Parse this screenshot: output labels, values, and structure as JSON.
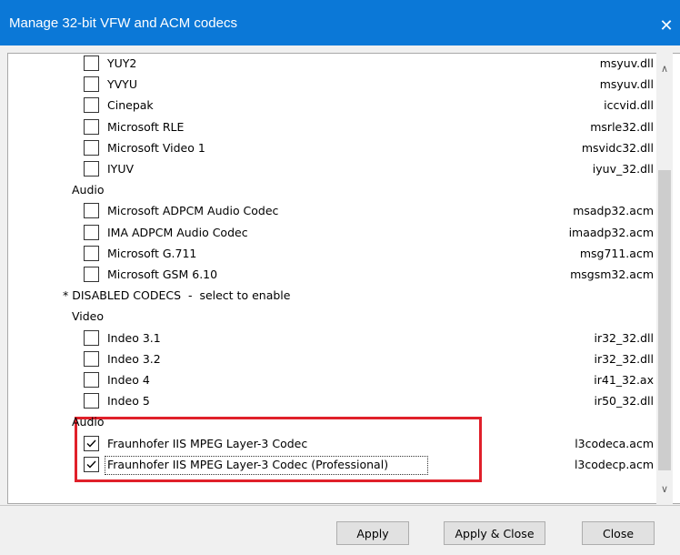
{
  "window": {
    "title": "Manage 32-bit VFW and ACM codecs",
    "close_glyph": "✕"
  },
  "list": {
    "rows": [
      {
        "type": "codec",
        "label": "YUY2",
        "file": "msyuv.dll",
        "checked": false
      },
      {
        "type": "codec",
        "label": "YVYU",
        "file": "msyuv.dll",
        "checked": false
      },
      {
        "type": "codec",
        "label": "Cinepak",
        "file": "iccvid.dll",
        "checked": false
      },
      {
        "type": "codec",
        "label": "Microsoft RLE",
        "file": "msrle32.dll",
        "checked": false
      },
      {
        "type": "codec",
        "label": "Microsoft Video 1",
        "file": "msvidc32.dll",
        "checked": false
      },
      {
        "type": "codec",
        "label": "IYUV",
        "file": "iyuv_32.dll",
        "checked": false
      },
      {
        "type": "group",
        "label": "Audio"
      },
      {
        "type": "codec",
        "label": "Microsoft ADPCM Audio Codec",
        "file": "msadp32.acm",
        "checked": false
      },
      {
        "type": "codec",
        "label": "IMA ADPCM Audio Codec",
        "file": "imaadp32.acm",
        "checked": false
      },
      {
        "type": "codec",
        "label": "Microsoft G.711",
        "file": "msg711.acm",
        "checked": false
      },
      {
        "type": "codec",
        "label": "Microsoft GSM 6.10",
        "file": "msgsm32.acm",
        "checked": false
      },
      {
        "type": "section",
        "label": "* DISABLED CODECS  -  select to enable"
      },
      {
        "type": "group",
        "label": "Video"
      },
      {
        "type": "codec",
        "label": "Indeo 3.1",
        "file": "ir32_32.dll",
        "checked": false
      },
      {
        "type": "codec",
        "label": "Indeo 3.2",
        "file": "ir32_32.dll",
        "checked": false
      },
      {
        "type": "codec",
        "label": "Indeo 4",
        "file": "ir41_32.ax",
        "checked": false
      },
      {
        "type": "codec",
        "label": "Indeo 5",
        "file": "ir50_32.dll",
        "checked": false
      },
      {
        "type": "group",
        "label": "Audio"
      },
      {
        "type": "codec",
        "label": "Fraunhofer IIS MPEG Layer-3 Codec",
        "file": "l3codeca.acm",
        "checked": true
      },
      {
        "type": "codec",
        "label": "Fraunhofer IIS MPEG Layer-3 Codec (Professional)",
        "file": "l3codecp.acm",
        "checked": true,
        "focused": true
      }
    ]
  },
  "scrollbar": {
    "up_glyph": "∧",
    "down_glyph": "∨"
  },
  "buttons": {
    "apply": "Apply",
    "apply_close": "Apply & Close",
    "close": "Close"
  },
  "colors": {
    "titlebar": "#0b78d7",
    "highlight": "#e0202a"
  }
}
